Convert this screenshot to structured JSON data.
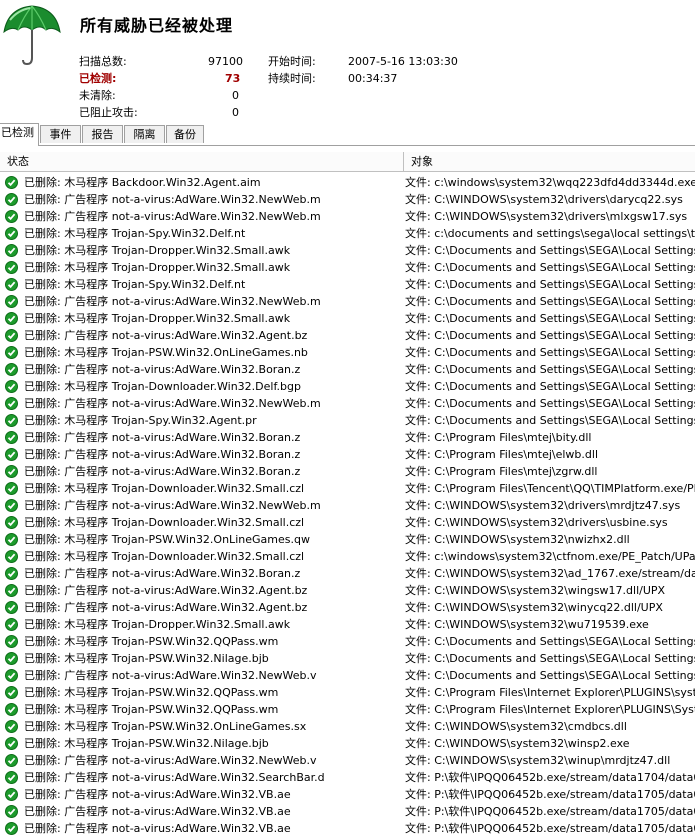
{
  "title": "所有威胁已经被处理",
  "stats": {
    "scanned_label": "扫描总数:",
    "scanned_value": "97100",
    "detected_label": "已检测:",
    "detected_value": "73",
    "uncleaned_label": "未清除:",
    "uncleaned_value": "0",
    "blocked_label": "已阻止攻击:",
    "blocked_value": "0",
    "start_label": "开始时间:",
    "start_value": "2007-5-16 13:03:30",
    "duration_label": "持续时间:",
    "duration_value": "00:34:37"
  },
  "tabs": [
    "已检测",
    "事件",
    "报告",
    "隔离",
    "备份"
  ],
  "columns": {
    "status": "状态",
    "object": "对象"
  },
  "rows": [
    {
      "status": "已删除: 木马程序 Backdoor.Win32.Agent.aim",
      "object": "文件: c:\\windows\\system32\\wqq223dfd4dd3344d.exe"
    },
    {
      "status": "已删除: 广告程序 not-a-virus:AdWare.Win32.NewWeb.m",
      "object": "文件: C:\\WINDOWS\\system32\\drivers\\darycq22.sys"
    },
    {
      "status": "已删除: 广告程序 not-a-virus:AdWare.Win32.NewWeb.m",
      "object": "文件: C:\\WINDOWS\\system32\\drivers\\mlxgsw17.sys"
    },
    {
      "status": "已删除: 木马程序 Trojan-Spy.Win32.Delf.nt",
      "object": "文件: c:\\documents and settings\\sega\\local settings\\temp\\ra"
    },
    {
      "status": "已删除: 木马程序 Trojan-Dropper.Win32.Small.awk",
      "object": "文件: C:\\Documents and Settings\\SEGA\\Local Settings\\Temp"
    },
    {
      "status": "已删除: 木马程序 Trojan-Dropper.Win32.Small.awk",
      "object": "文件: C:\\Documents and Settings\\SEGA\\Local Settings\\Temp"
    },
    {
      "status": "已删除: 木马程序 Trojan-Spy.Win32.Delf.nt",
      "object": "文件: C:\\Documents and Settings\\SEGA\\Local Settings\\Temp"
    },
    {
      "status": "已删除: 广告程序 not-a-virus:AdWare.Win32.NewWeb.m",
      "object": "文件: C:\\Documents and Settings\\SEGA\\Local Settings\\Temp"
    },
    {
      "status": "已删除: 木马程序 Trojan-Dropper.Win32.Small.awk",
      "object": "文件: C:\\Documents and Settings\\SEGA\\Local Settings\\Temp"
    },
    {
      "status": "已删除: 广告程序 not-a-virus:AdWare.Win32.Agent.bz",
      "object": "文件: C:\\Documents and Settings\\SEGA\\Local Settings\\Temp"
    },
    {
      "status": "已删除: 木马程序 Trojan-PSW.Win32.OnLineGames.nb",
      "object": "文件: C:\\Documents and Settings\\SEGA\\Local Settings\\Temp"
    },
    {
      "status": "已删除: 广告程序 not-a-virus:AdWare.Win32.Boran.z",
      "object": "文件: C:\\Documents and Settings\\SEGA\\Local Settings\\Temp"
    },
    {
      "status": "已删除: 木马程序 Trojan-Downloader.Win32.Delf.bgp",
      "object": "文件: C:\\Documents and Settings\\SEGA\\Local Settings\\Temp"
    },
    {
      "status": "已删除: 广告程序 not-a-virus:AdWare.Win32.NewWeb.m",
      "object": "文件: C:\\Documents and Settings\\SEGA\\Local Settings\\Temp"
    },
    {
      "status": "已删除: 木马程序 Trojan-Spy.Win32.Agent.pr",
      "object": "文件: C:\\Documents and Settings\\SEGA\\Local Settings\\Temp"
    },
    {
      "status": "已删除: 广告程序 not-a-virus:AdWare.Win32.Boran.z",
      "object": "文件: C:\\Program Files\\mtej\\bity.dll"
    },
    {
      "status": "已删除: 广告程序 not-a-virus:AdWare.Win32.Boran.z",
      "object": "文件: C:\\Program Files\\mtej\\elwb.dll"
    },
    {
      "status": "已删除: 广告程序 not-a-virus:AdWare.Win32.Boran.z",
      "object": "文件: C:\\Program Files\\mtej\\zgrw.dll"
    },
    {
      "status": "已删除: 木马程序 Trojan-Downloader.Win32.Small.czl",
      "object": "文件: C:\\Program Files\\Tencent\\QQ\\TIMPlatform.exe/PE_Pa"
    },
    {
      "status": "已删除: 广告程序 not-a-virus:AdWare.Win32.NewWeb.m",
      "object": "文件: C:\\WINDOWS\\system32\\drivers\\mrdjtz47.sys"
    },
    {
      "status": "已删除: 木马程序 Trojan-Downloader.Win32.Small.czl",
      "object": "文件: C:\\WINDOWS\\system32\\drivers\\usbine.sys"
    },
    {
      "status": "已删除: 木马程序 Trojan-PSW.Win32.OnLineGames.qw",
      "object": "文件: C:\\WINDOWS\\system32\\nwizhx2.dll"
    },
    {
      "status": "已删除: 木马程序 Trojan-Downloader.Win32.Small.czl",
      "object": "文件: c:\\windows\\system32\\ctfnom.exe/PE_Patch/UPack"
    },
    {
      "status": "已删除: 广告程序 not-a-virus:AdWare.Win32.Boran.z",
      "object": "文件: C:\\WINDOWS\\system32\\ad_1767.exe/stream/data00"
    },
    {
      "status": "已删除: 广告程序 not-a-virus:AdWare.Win32.Agent.bz",
      "object": "文件: C:\\WINDOWS\\system32\\wingsw17.dll/UPX"
    },
    {
      "status": "已删除: 广告程序 not-a-virus:AdWare.Win32.Agent.bz",
      "object": "文件: C:\\WINDOWS\\system32\\winycq22.dll/UPX"
    },
    {
      "status": "已删除: 木马程序 Trojan-Dropper.Win32.Small.awk",
      "object": "文件: C:\\WINDOWS\\system32\\wu719539.exe"
    },
    {
      "status": "已删除: 木马程序 Trojan-PSW.Win32.QQPass.wm",
      "object": "文件: C:\\Documents and Settings\\SEGA\\Local Settings\\Temp"
    },
    {
      "status": "已删除: 木马程序 Trojan-PSW.Win32.Nilage.bjb",
      "object": "文件: C:\\Documents and Settings\\SEGA\\Local Settings\\Temp"
    },
    {
      "status": "已删除: 广告程序 not-a-virus:AdWare.Win32.NewWeb.v",
      "object": "文件: C:\\Documents and Settings\\SEGA\\Local Settings\\Temp"
    },
    {
      "status": "已删除: 木马程序 Trojan-PSW.Win32.QQPass.wm",
      "object": "文件: C:\\Program Files\\Internet Explorer\\PLUGINS\\system32"
    },
    {
      "status": "已删除: 木马程序 Trojan-PSW.Win32.QQPass.wm",
      "object": "文件: C:\\Program Files\\Internet Explorer\\PLUGINS\\System6"
    },
    {
      "status": "已删除: 木马程序 Trojan-PSW.Win32.OnLineGames.sx",
      "object": "文件: C:\\WINDOWS\\system32\\cmdbcs.dll"
    },
    {
      "status": "已删除: 木马程序 Trojan-PSW.Win32.Nilage.bjb",
      "object": "文件: C:\\WINDOWS\\system32\\winsp2.exe"
    },
    {
      "status": "已删除: 广告程序 not-a-virus:AdWare.Win32.NewWeb.v",
      "object": "文件: C:\\WINDOWS\\system32\\winup\\mrdjtz47.dll"
    },
    {
      "status": "已删除: 广告程序 not-a-virus:AdWare.Win32.SearchBar.d",
      "object": "文件: P:\\软件\\IPQQ06452b.exe/stream/data1704/data0002"
    },
    {
      "status": "已删除: 广告程序 not-a-virus:AdWare.Win32.VB.ae",
      "object": "文件: P:\\软件\\IPQQ06452b.exe/stream/data1705/data0007"
    },
    {
      "status": "已删除: 广告程序 not-a-virus:AdWare.Win32.VB.ae",
      "object": "文件: P:\\软件\\IPQQ06452b.exe/stream/data1705/data001"
    },
    {
      "status": "已删除: 广告程序 not-a-virus:AdWare.Win32.VB.ae",
      "object": "文件: P:\\软件\\IPQQ06452b.exe/stream/data1705/data0011"
    }
  ]
}
